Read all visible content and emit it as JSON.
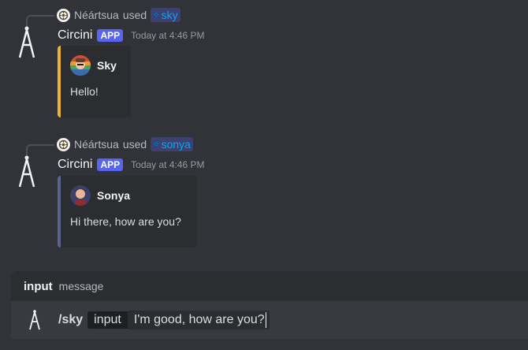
{
  "messages": [
    {
      "reply": {
        "user": "Néártsua",
        "used_text": "used",
        "command": "sky"
      },
      "author": "Circini",
      "badge": "APP",
      "timestamp": "Today at 4:46 PM",
      "embed": {
        "author": "Sky",
        "description": "Hello!",
        "accent": "#f0b232"
      }
    },
    {
      "reply": {
        "user": "Néártsua",
        "used_text": "used",
        "command": "sonya"
      },
      "author": "Circini",
      "badge": "APP",
      "timestamp": "Today at 4:46 PM",
      "embed": {
        "author": "Sonya",
        "description": "Hi there, how are you?",
        "accent": "#5c6392"
      }
    }
  ],
  "composer": {
    "option_name": "input",
    "option_description": "message",
    "command": "/sky",
    "param_name": "input",
    "param_value": "I'm good, how are you?"
  },
  "colors": {
    "background": "#313338",
    "app_badge": "#5865f2",
    "link": "#00a8fc"
  }
}
